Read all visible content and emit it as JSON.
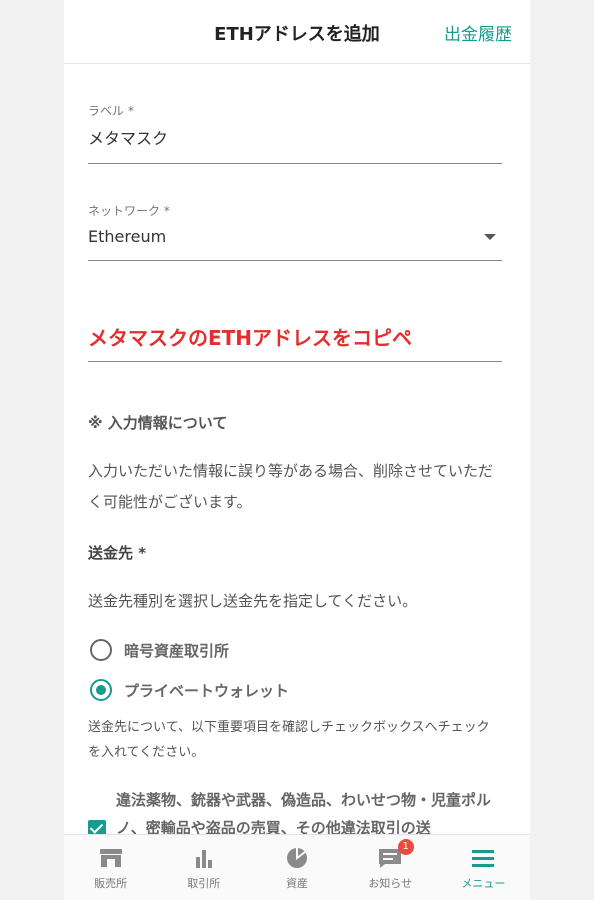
{
  "header": {
    "title": "ETHアドレスを追加",
    "history_link": "出金履歴"
  },
  "form": {
    "label_field": {
      "label": "ラベル *",
      "value": "メタマスク"
    },
    "network_field": {
      "label": "ネットワーク *",
      "value": "Ethereum"
    },
    "address_field": {
      "value": "メタマスクのETHアドレスをコピペ"
    }
  },
  "notice": {
    "title": "※ 入力情報について",
    "body": "入力いただいた情報に誤り等がある場合、削除させていただく可能性がございます。"
  },
  "destination": {
    "title": "送金先 *",
    "instruction": "送金先種別を選択し送金先を指定してください。",
    "options": [
      {
        "label": "暗号資産取引所",
        "selected": false
      },
      {
        "label": "プライベートウォレット",
        "selected": true
      }
    ],
    "confirm_text": "送金先について、以下重要項目を確認しチェックボックスへチェックを入れてください。",
    "warning_text": "違法薬物、銃器や武器、偽造品、わいせつ物・児童ポルノ、密輸品や盗品の売買、その他違法取引の送"
  },
  "tabbar": {
    "items": [
      {
        "label": "販売所",
        "icon": "store-icon"
      },
      {
        "label": "取引所",
        "icon": "bar-chart-icon"
      },
      {
        "label": "資産",
        "icon": "pie-chart-icon"
      },
      {
        "label": "お知らせ",
        "icon": "chat-icon",
        "badge": "1"
      },
      {
        "label": "メニュー",
        "icon": "menu-icon",
        "active": true
      }
    ]
  },
  "colors": {
    "accent": "#169c8f",
    "highlight": "#e62c2c"
  }
}
